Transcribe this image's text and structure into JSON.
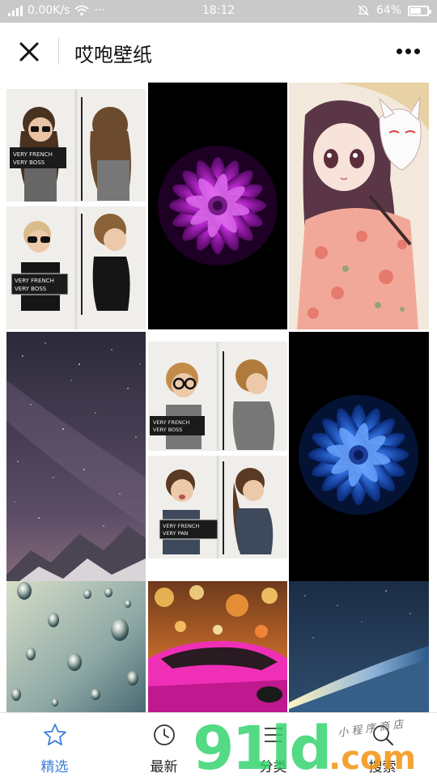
{
  "status_bar": {
    "network_speed": "0.00K/s",
    "ellipsis": "···",
    "time": "18:12",
    "battery": "64%",
    "battery_level": 0.64
  },
  "header": {
    "title": "哎咆壁纸"
  },
  "tabs": [
    {
      "label": "精选",
      "icon": "star-icon",
      "active": true
    },
    {
      "label": "最新",
      "icon": "clock-icon",
      "active": false
    },
    {
      "label": "分类",
      "icon": "list-icon",
      "active": false
    },
    {
      "label": "搜索",
      "icon": "search-icon",
      "active": false
    }
  ],
  "watermark": {
    "logo": "91ld.com",
    "tagline": "小 程 序 商 店"
  },
  "colors": {
    "accent": "#3b7fd9",
    "status_bar": "#c9c9c9",
    "watermark_green": "#2fd36b",
    "watermark_orange": "#f39a1e"
  },
  "wallpapers": [
    {
      "subject": "kids-mugshot-photo-wallpaper"
    },
    {
      "subject": "magenta-flower-wallpaper"
    },
    {
      "subject": "anime-girl-fox-mask-wallpaper"
    },
    {
      "subject": "starry-night-mountain-wallpaper"
    },
    {
      "subject": "kids-mugshot-photo-wallpaper-2"
    },
    {
      "subject": "blue-flower-wallpaper"
    },
    {
      "subject": "raindrops-glass-wallpaper"
    },
    {
      "subject": "pink-sports-car-wallpaper"
    },
    {
      "subject": "earth-from-space-wallpaper"
    }
  ]
}
